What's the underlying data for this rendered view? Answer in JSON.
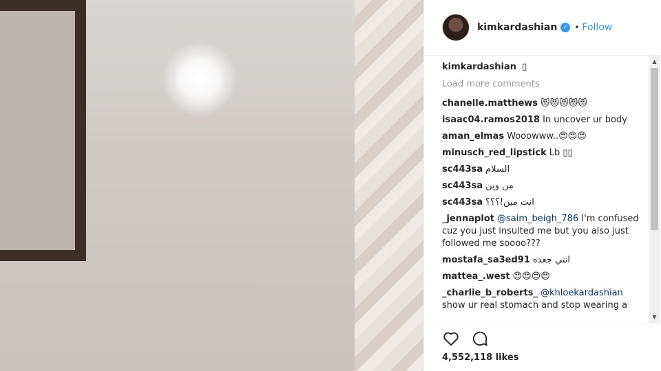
{
  "post": {
    "photo_alt": ""
  },
  "header": {
    "username": "kimkardashian",
    "verified_icon": "verified-badge-icon",
    "separator": "•",
    "follow_label": "Follow"
  },
  "caption": {
    "username": "kimkardashian",
    "text": "▯"
  },
  "load_more_label": "Load more comments",
  "comments": [
    {
      "user": "chanelle.matthews",
      "mention": "",
      "text": "😻😻😻😻😻"
    },
    {
      "user": "isaac04.ramos2018",
      "mention": "",
      "text": "In uncover ur body"
    },
    {
      "user": "aman_elmas",
      "mention": "",
      "text": "Wooowww..😍😍😍"
    },
    {
      "user": "minusch_red_lipstick",
      "mention": "",
      "text": "Lb ▯▯"
    },
    {
      "user": "sc443sa",
      "mention": "",
      "text": "السلام"
    },
    {
      "user": "sc443sa",
      "mention": "",
      "text": "من وين"
    },
    {
      "user": "sc443sa",
      "mention": "",
      "text": "انت مين!؟؟؟"
    },
    {
      "user": "_jennaplot",
      "mention": "@saim_beigh_786",
      "text": "I'm confused cuz you just insulted me but you also just followed me soooo???"
    },
    {
      "user": "mostafa_sa3ed91",
      "mention": "",
      "text": "انتي جعده"
    },
    {
      "user": "mattea_.west",
      "mention": "",
      "text": "😍😍😍😍"
    },
    {
      "user": "_charlie_b_roberts_",
      "mention": "@khloekardashian",
      "text": "show ur real stomach and stop wearing a"
    }
  ],
  "actions": {
    "like_icon": "heart-icon",
    "comment_icon": "comment-bubble-icon"
  },
  "likes_label": "4,552,118 likes"
}
